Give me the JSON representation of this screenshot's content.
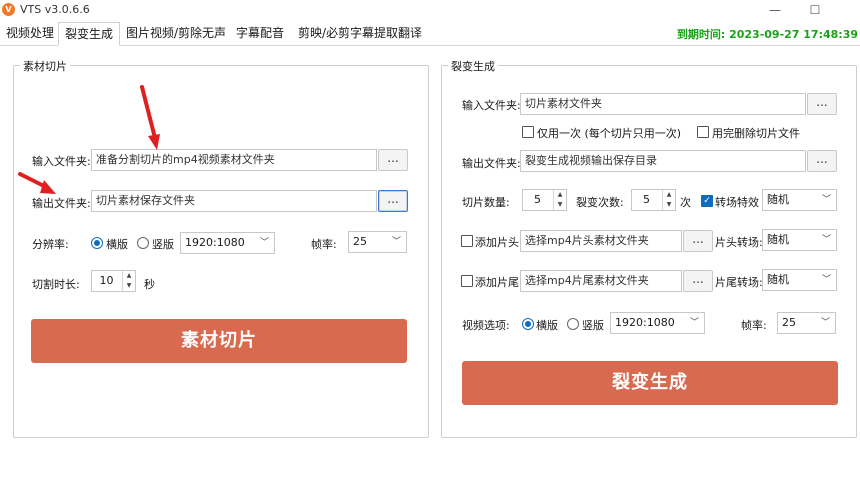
{
  "window": {
    "title": "VTS v3.0.6.6",
    "app_icon_text": "V",
    "minimize_icon": "minimize-icon",
    "maximize_icon": "maximize-icon"
  },
  "tabs": [
    {
      "label": "视频处理"
    },
    {
      "label": "裂变生成"
    },
    {
      "label": "图片视频/剪除无声"
    },
    {
      "label": "字幕配音"
    },
    {
      "label": "剪映/必剪字幕提取翻译"
    }
  ],
  "active_tab_index": 1,
  "expiry_text": "到期时间: 2023-09-27 17:48:39",
  "colors": {
    "accent": "#d86a50",
    "expiry_green": "#19a319",
    "annotation_red": "#e02020",
    "check_blue": "#0f6cbd"
  },
  "left_panel": {
    "title": "素材切片",
    "input_folder_label": "输入文件夹:",
    "input_folder_value": "准备分割切片的mp4视频素材文件夹",
    "output_folder_label": "输出文件夹:",
    "output_folder_value": "切片素材保存文件夹",
    "browse_label": "...",
    "resolution_label": "分辨率:",
    "landscape_label": "横版",
    "portrait_label": "竖版",
    "orientation_selected": "横版",
    "resolution_value": "1920:1080",
    "fps_label": "帧率:",
    "fps_value": "25",
    "duration_label": "切割时长:",
    "duration_value": "10",
    "duration_unit": "秒",
    "action_button": "素材切片"
  },
  "right_panel": {
    "title": "裂变生成",
    "input_folder_label": "输入文件夹:",
    "input_folder_value": "切片素材文件夹",
    "only_once_label": "仅用一次 (每个切片只用一次)",
    "only_once_checked": false,
    "delete_after_label": "用完删除切片文件",
    "delete_after_checked": false,
    "output_folder_label": "输出文件夹:",
    "output_folder_value": "裂变生成视频输出保存目录",
    "browse_label": "...",
    "slice_count_label": "切片数量:",
    "slice_count_value": "5",
    "fission_count_label": "裂变次数:",
    "fission_count_value": "5",
    "fission_count_unit": "次",
    "transition_label": "转场特效",
    "transition_checked": true,
    "transition_value": "随机",
    "add_head_label": "添加片头",
    "add_head_checked": false,
    "head_folder_value": "选择mp4片头素材文件夹",
    "head_transition_label": "片头转场:",
    "head_transition_value": "随机",
    "add_tail_label": "添加片尾",
    "add_tail_checked": false,
    "tail_folder_value": "选择mp4片尾素材文件夹",
    "tail_transition_label": "片尾转场:",
    "tail_transition_value": "随机",
    "video_option_label": "视频选项:",
    "landscape_label": "横版",
    "portrait_label": "竖版",
    "orientation_selected": "横版",
    "resolution_value": "1920:1080",
    "fps_label": "帧率:",
    "fps_value": "25",
    "action_button": "裂变生成"
  }
}
